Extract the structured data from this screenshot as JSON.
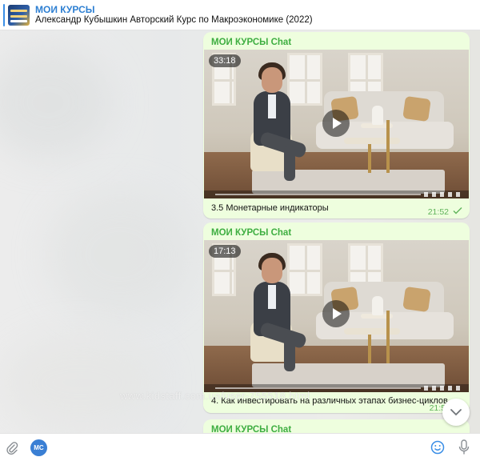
{
  "pinned": {
    "title": "МОИ КУРСЫ",
    "text": "Александр Кубышкин  Авторский Курс по Макроэкономике (2022)"
  },
  "messages": [
    {
      "sender": "МОИ КУРСЫ Chat",
      "duration": "33:18",
      "caption": "3.5 Монетарные индикаторы",
      "time": "21:52",
      "read": true
    },
    {
      "sender": "МОИ КУРСЫ Chat",
      "duration": "17:13",
      "caption": "4. Как инвестировать на различных этапах бизнес-циклов",
      "time": "21:5",
      "read": false
    },
    {
      "sender": "МОИ КУРСЫ Chat"
    }
  ],
  "watermark": "www.kidstaff.com.ua/user-755518.html",
  "composer": {
    "avatar_initials": "МС"
  },
  "colors": {
    "accent": "#2d7fd2",
    "sender": "#3eae41",
    "bubble": "#eefede"
  },
  "icons": [
    "paperclip-icon",
    "emoji-icon",
    "microphone-icon",
    "chevron-down-icon",
    "play-icon",
    "double-check-icon"
  ]
}
